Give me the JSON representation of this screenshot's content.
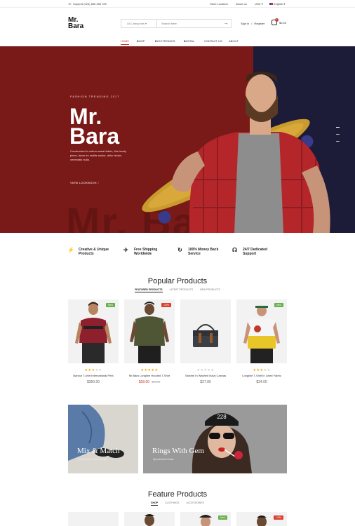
{
  "topbar": {
    "support": "Support (024) 666 456 789",
    "store_location": "Store Location",
    "about_us": "About us",
    "currency": "USD",
    "language": "English"
  },
  "header": {
    "logo_line1": "Mr.",
    "logo_line2": "Bara",
    "category_select": "All Categories",
    "search_placeholder": "Search here",
    "sign_in": "Sign in",
    "register": "Register",
    "cart_total": "$0.00",
    "cart_count": "0"
  },
  "nav": {
    "items": [
      "HOME",
      "SHOP",
      "ELECTRONICS",
      "DIGITAL",
      "CONTACT US",
      "ABOUT"
    ]
  },
  "hero": {
    "tag": "FASHION TRENDING 2017",
    "title_line1": "Mr.",
    "title_line2": "Bara",
    "description": "Constructed in cotton sweat fabric, this lovely piece, lacus eu mattis auctor, dolor lectus venenatis nulla.",
    "cta": "VIEW LOOKBOOK",
    "shadow_text": "Mr. Bara",
    "colors": {
      "left": "#7a1a18",
      "right": "#1c1b38"
    }
  },
  "features": [
    {
      "icon": "lightning-icon",
      "line1": "Creative & Unique",
      "line2": "Products"
    },
    {
      "icon": "plane-icon",
      "line1": "Free Shipping",
      "line2": "Worldwide"
    },
    {
      "icon": "refresh-icon",
      "line1": "100% Money Back",
      "line2": "Service"
    },
    {
      "icon": "headset-icon",
      "line1": "24/7 Dedicated",
      "line2": "Support"
    }
  ],
  "popular": {
    "title": "Popular Products",
    "tabs": [
      "FEATURED PRODUCTS",
      "LATEST PRODUCTS",
      "NEW PRODUCTS"
    ],
    "products": [
      {
        "name": "Barlout T-shirt International Print",
        "price": "$350.00",
        "old_price": "",
        "badge": "New",
        "rating": 3
      },
      {
        "name": "Mr.Bara Longline Hooded T-Shirt",
        "price": "$18.00",
        "old_price": "$20.00",
        "badge": "-10%",
        "rating": 5
      },
      {
        "name": "Satchel In Washed Navy Canvas",
        "price": "$27.00",
        "old_price": "",
        "badge": "",
        "rating": 0
      },
      {
        "name": "Longline T-Shirt In Lined Fabric",
        "price": "$34.00",
        "old_price": "",
        "badge": "New",
        "rating": 3
      }
    ]
  },
  "banners": [
    {
      "title": "Mix & Match",
      "subtitle": "Trending for Smashin Style"
    },
    {
      "title": "Rings With Gem",
      "subtitle": "Special New Deals"
    }
  ],
  "feature_products": {
    "title": "Feature Products",
    "tabs": [
      "SHOP",
      "CLOTHINGS",
      "ACCESSORIES"
    ],
    "badges": [
      "New",
      "-10%"
    ]
  }
}
